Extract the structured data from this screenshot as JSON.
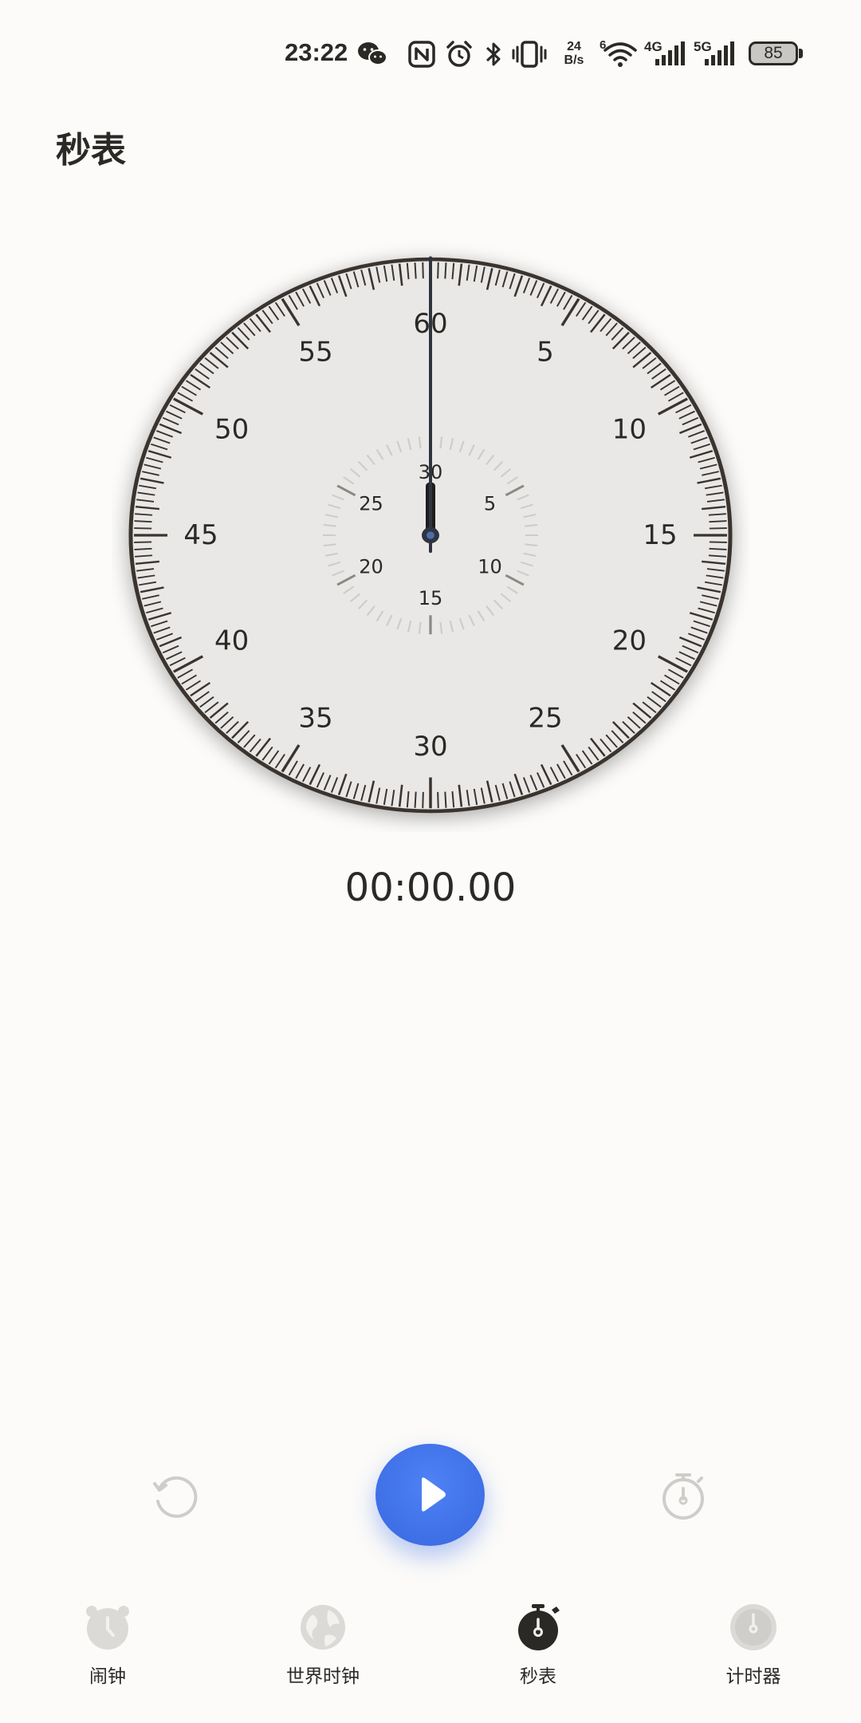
{
  "status_bar": {
    "time": "23:22",
    "net_speed_value": "24",
    "net_speed_unit": "B/s",
    "wifi_label": "6",
    "signal_1_label": "4G",
    "signal_2_label": "5G",
    "battery_level": "85",
    "icons": [
      "wechat-icon",
      "nfc-icon",
      "alarm-icon",
      "bluetooth-icon",
      "vibrate-icon",
      "wifi-icon",
      "signal-icon",
      "signal-icon",
      "battery-icon"
    ]
  },
  "page": {
    "title": "秒表"
  },
  "dial": {
    "outer_numbers": [
      "60",
      "5",
      "10",
      "15",
      "20",
      "25",
      "30",
      "35",
      "40",
      "45",
      "50",
      "55"
    ],
    "inner_numbers": [
      "30",
      "5",
      "10",
      "15",
      "20",
      "25"
    ],
    "second_hand_value": 0,
    "minute_hand_value": 0
  },
  "stopwatch": {
    "elapsed": "00:00.00"
  },
  "controls": {
    "reset_icon": "reset-icon",
    "start_icon": "play-icon",
    "lap_icon": "lap-stopwatch-icon",
    "accent_color": "#3e6fe6"
  },
  "bottom_nav": {
    "items": [
      {
        "label": "闹钟",
        "icon": "alarm-clock-icon",
        "active": false
      },
      {
        "label": "世界时钟",
        "icon": "globe-icon",
        "active": false
      },
      {
        "label": "秒表",
        "icon": "stopwatch-icon",
        "active": true
      },
      {
        "label": "计时器",
        "icon": "timer-icon",
        "active": false
      }
    ],
    "active_color": "#2b2926",
    "inactive_color": "#d6d4d1"
  }
}
